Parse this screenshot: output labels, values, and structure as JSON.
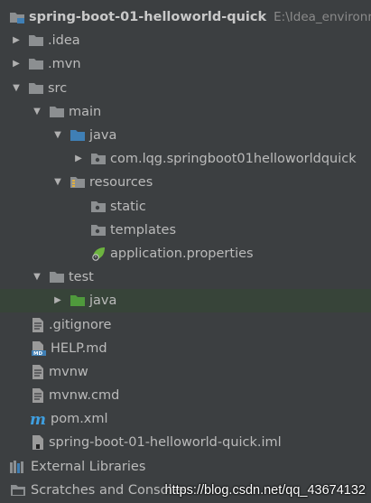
{
  "project": {
    "name": "spring-boot-01-helloworld-quick",
    "path": "E:\\Idea_environm"
  },
  "tree": {
    "idea": ".idea",
    "mvn": ".mvn",
    "src": "src",
    "main": "main",
    "java": "java",
    "package": "com.lqg.springboot01helloworldquick",
    "resources": "resources",
    "static": "static",
    "templates": "templates",
    "app_props": "application.properties",
    "test": "test",
    "test_java": "java",
    "gitignore": ".gitignore",
    "help": "HELP.md",
    "mvnw": "mvnw",
    "mvnw_cmd": "mvnw.cmd",
    "pom": "pom.xml",
    "iml": "spring-boot-01-helloworld-quick.iml",
    "ext_libs": "External Libraries",
    "scratches": "Scratches and Consoles"
  },
  "watermark": "https://blog.csdn.net/qq_43674132",
  "colors": {
    "background": "#3c3f41",
    "selected_row": "#374439",
    "folder": "#8c8f91",
    "source_folder": "#3f7fb5",
    "test_folder": "#4f9a3c",
    "spring": "#6cb33f"
  }
}
